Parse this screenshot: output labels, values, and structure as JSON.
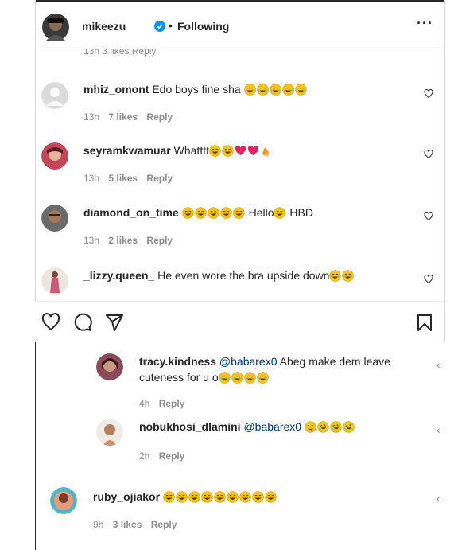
{
  "header": {
    "username": "mikeezu",
    "separator": "•",
    "following_label": "Following",
    "more_label": "···"
  },
  "cut_meta": "13h  3 likes  Reply",
  "comments": [
    {
      "username": "mhiz_omont",
      "text": "Edo boys fine sha",
      "emojis": [
        "laugh",
        "laugh",
        "laugh",
        "laugh",
        "laugh"
      ],
      "time": "13h",
      "likes": "7 likes",
      "reply": "Reply"
    },
    {
      "username": "seyramkwamuar",
      "text": "Whatttt",
      "emojis": [
        "laugh",
        "laugh",
        "heart",
        "heart",
        "fire"
      ],
      "time": "13h",
      "likes": "5 likes",
      "reply": "Reply"
    },
    {
      "username": "diamond_on_time",
      "text_before": "",
      "emojis_before": [
        "laugh",
        "laugh",
        "laugh",
        "laugh",
        "laugh"
      ],
      "text": "Hello",
      "emojis": [
        "laugh"
      ],
      "text_after": "HBD",
      "time": "13h",
      "likes": "2 likes",
      "reply": "Reply"
    },
    {
      "username": "_lizzy.queen_",
      "text": "He even wore the bra upside down",
      "emojis": [
        "laugh",
        "laugh"
      ]
    }
  ],
  "replies": [
    {
      "username": "tracy.kindness",
      "mention": "@babarex0",
      "text_line1": "Abeg make dem leave",
      "text_line2": "cuteness for u o",
      "emojis": [
        "laugh",
        "laugh",
        "laugh",
        "laugh"
      ],
      "time": "4h",
      "reply": "Reply"
    },
    {
      "username": "nobukhosi_dlamini",
      "mention": "@babarex0",
      "emojis": [
        "yum",
        "rofl",
        "rofl",
        "rofl"
      ],
      "time": "2h",
      "reply": "Reply"
    }
  ],
  "ruby": {
    "username": "ruby_ojiakor",
    "emojis": [
      "laugh",
      "laugh",
      "laugh",
      "laugh",
      "laugh",
      "laugh",
      "laugh",
      "laugh",
      "laugh"
    ],
    "time": "9h",
    "likes": "3 likes",
    "reply": "Reply"
  },
  "colors": {
    "text": "#262626",
    "muted": "#8e8e8e",
    "verified": "#0095f6",
    "mention": "#00376b",
    "emoji": "#f5c518",
    "heart": "#e0245e"
  },
  "icons": [
    "heart-icon",
    "comment-icon",
    "share-icon",
    "bookmark-icon",
    "verified-badge-icon",
    "more-icon"
  ]
}
